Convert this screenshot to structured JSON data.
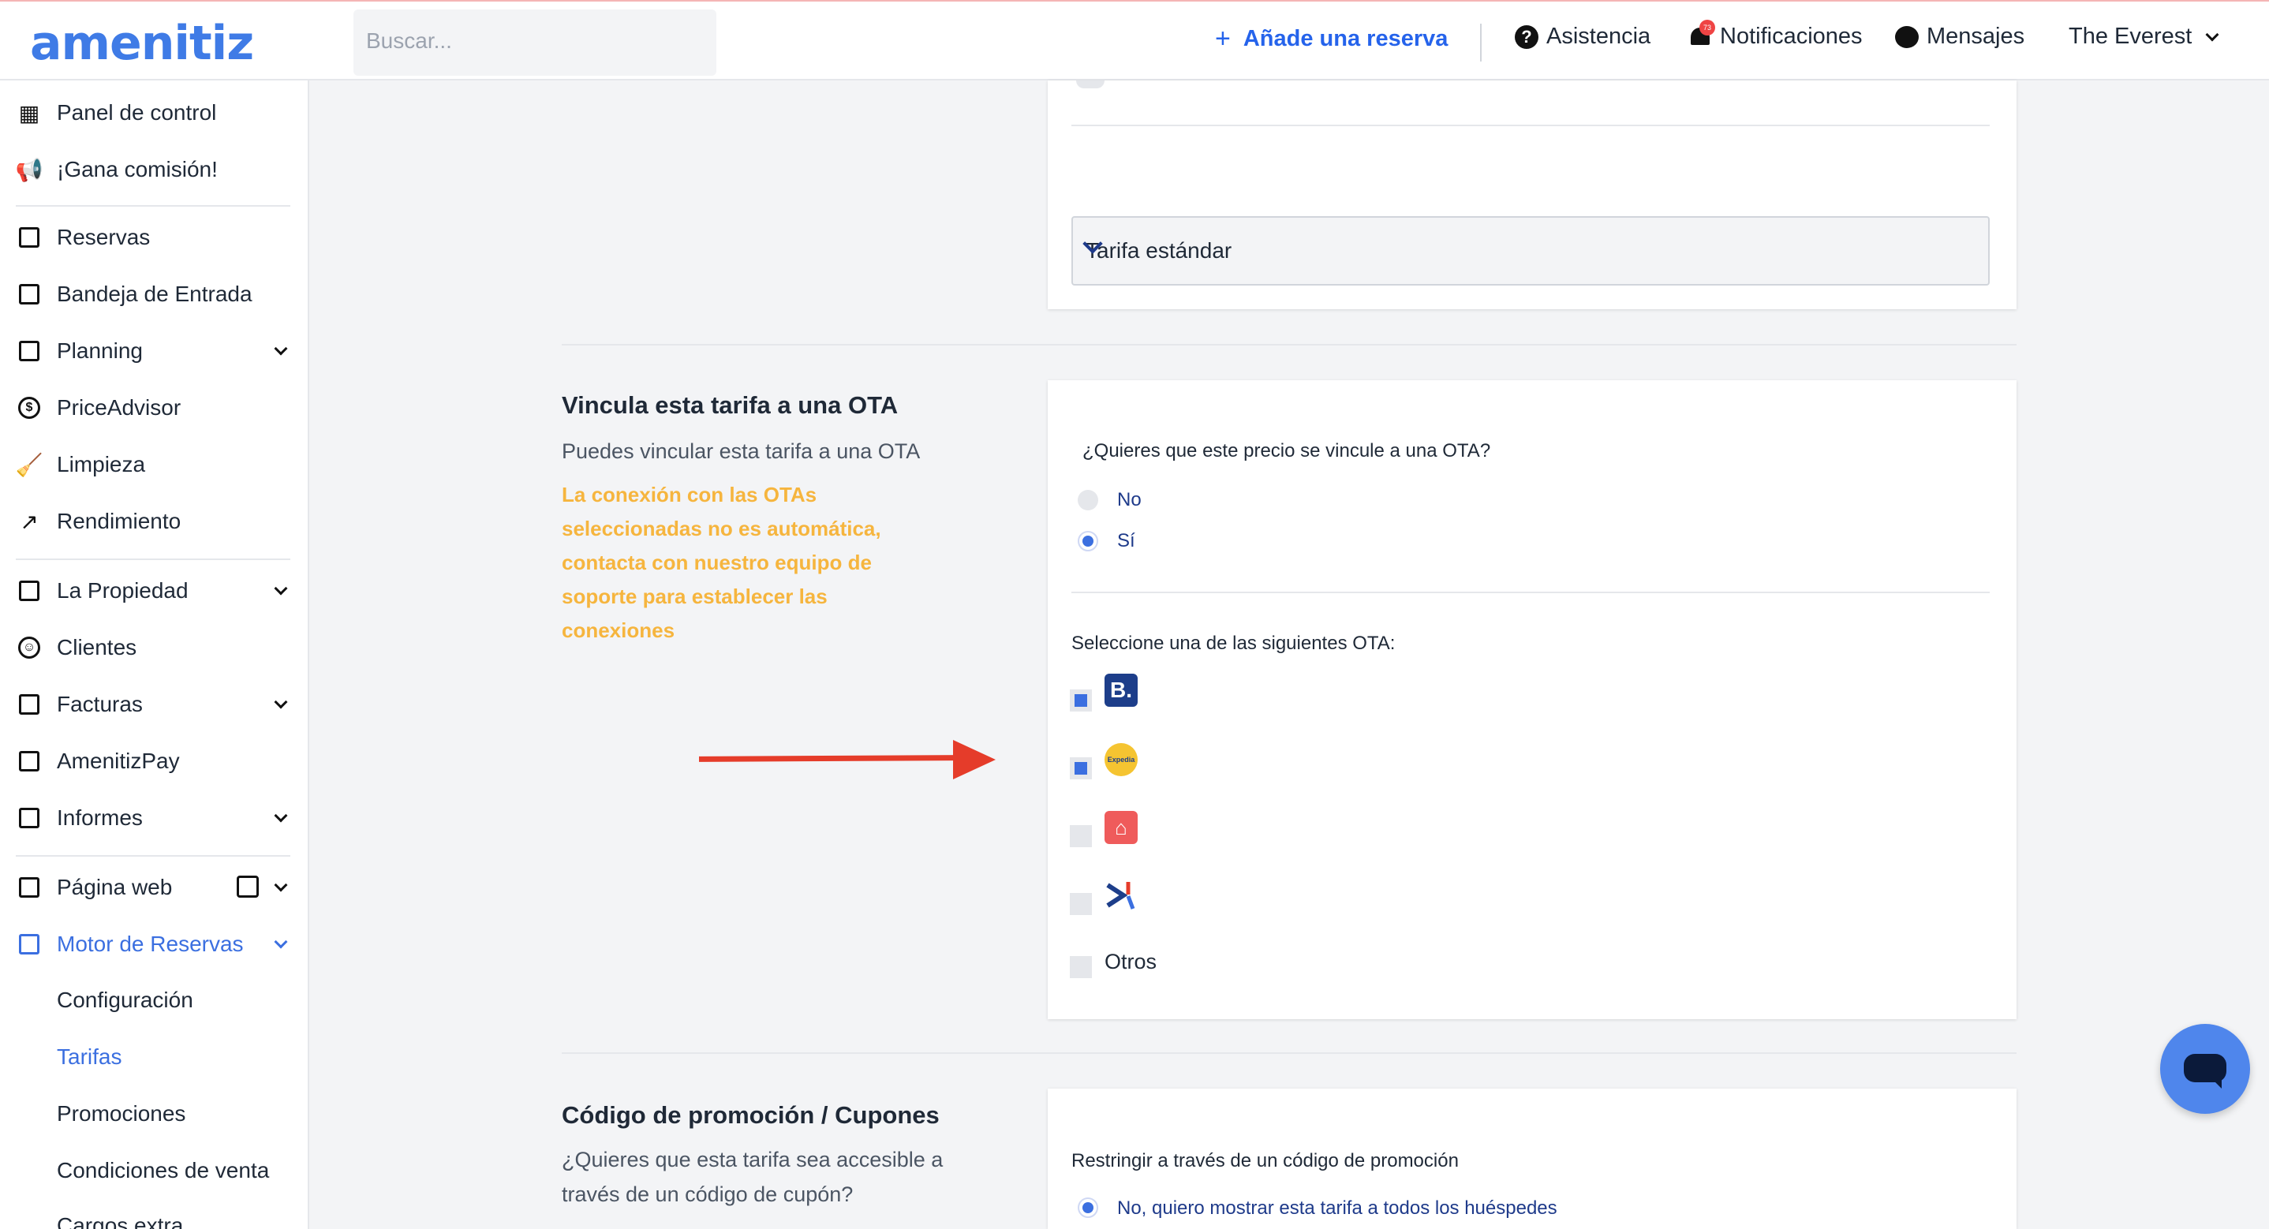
{
  "header": {
    "logo": "amenitiz",
    "search_placeholder": "Buscar...",
    "add_reservation": "Añade una reserva",
    "help": "Asistencia",
    "notifications": "Notificaciones",
    "notifications_count": "73",
    "messages": "Mensajes",
    "property": "The Everest"
  },
  "sidebar": {
    "items": [
      {
        "label": "Panel de control",
        "icon": "dashboard-icon"
      },
      {
        "label": "¡Gana comisión!",
        "icon": "megaphone-icon"
      },
      {
        "label": "Reservas",
        "icon": "suitcase-icon"
      },
      {
        "label": "Bandeja de Entrada",
        "icon": "inbox-icon"
      },
      {
        "label": "Planning",
        "icon": "calendar-icon"
      },
      {
        "label": "PriceAdvisor",
        "icon": "dollar-icon"
      },
      {
        "label": "Limpieza",
        "icon": "broom-icon"
      },
      {
        "label": "Rendimiento",
        "icon": "trend-icon"
      },
      {
        "label": "La Propiedad",
        "icon": "building-icon"
      },
      {
        "label": "Clientes",
        "icon": "users-icon"
      },
      {
        "label": "Facturas",
        "icon": "invoice-icon"
      },
      {
        "label": "AmenitizPay",
        "icon": "card-icon"
      },
      {
        "label": "Informes",
        "icon": "chart-icon"
      },
      {
        "label": "Página web",
        "icon": "browser-icon"
      },
      {
        "label": "Motor de Reservas",
        "icon": "booking-engine-icon"
      }
    ],
    "subitems": [
      "Configuración",
      "Tarifas",
      "Promociones",
      "Condiciones de venta",
      "Cargos extra"
    ]
  },
  "top_card": {
    "select_value": "Tarifa estándar"
  },
  "ota_section": {
    "title": "Vincula esta tarifa a una OTA",
    "subtitle": "Puedes vincular esta tarifa a una OTA",
    "warning": "La conexión con las OTAs seleccionadas no es automática, contacta con nuestro equipo de soporte para establecer las conexiones",
    "question": "¿Quieres que este precio se vincule a una OTA?",
    "option_no": "No",
    "option_yes": "Sí",
    "selected": "Sí",
    "select_label": "Seleccione una de las siguientes OTA:",
    "otas": [
      {
        "name": "booking",
        "checked": true,
        "glyph": "B."
      },
      {
        "name": "expedia",
        "checked": true,
        "glyph": "Expedia"
      },
      {
        "name": "airbnb",
        "checked": false,
        "glyph": "⌂"
      },
      {
        "name": "other-ota",
        "checked": false,
        "glyph": ""
      }
    ],
    "others_label": "Otros"
  },
  "promo_section": {
    "title": "Código de promoción / Cupones",
    "subtitle": "¿Quieres que esta tarifa sea accesible a través de un código de cupón?",
    "question": "Restringir a través de un código de promoción",
    "option_no": "No, quiero mostrar esta tarifa a todos los huéspedes"
  },
  "colors": {
    "accent": "#3b6fe0",
    "warning": "#f6b53e",
    "arrow": "#e53c2a"
  }
}
